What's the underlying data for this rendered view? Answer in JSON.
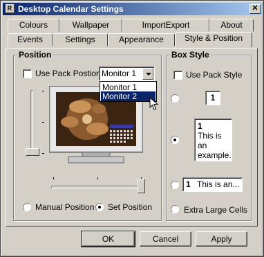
{
  "window": {
    "title": "Desktop Calendar Settings",
    "app_icon_glyph": "R",
    "close_glyph": "✕"
  },
  "tabs_row_top": [
    "Colours",
    "Wallpaper",
    "ImportExport",
    "About"
  ],
  "tabs_row_bottom": [
    "Events",
    "Settings",
    "Appearance",
    "Style & Position"
  ],
  "active_tab": "Style & Position",
  "position": {
    "label": "Position",
    "use_pack_position_label": "Use Pack Postion",
    "use_pack_position_checked": false,
    "monitor_select_value": "Monitor 1",
    "monitor_options": [
      "Monitor 1",
      "Monitor 2"
    ],
    "highlighted_option": "Monitor 2",
    "manual_position_label": "Manual Position",
    "set_position_label": "Set Position",
    "selected_mode": "Set Position"
  },
  "box_style": {
    "label": "Box Style",
    "use_pack_style_label": "Use Pack Style",
    "use_pack_style_checked": false,
    "option1_number": "1",
    "option2_number": "1",
    "option2_text": "This is an example.",
    "option3_number": "1",
    "option3_text": "This is an...",
    "option4_label": "Extra Large Cells",
    "selected_option": 2
  },
  "buttons": {
    "ok": "OK",
    "cancel": "Cancel",
    "apply": "Apply"
  }
}
